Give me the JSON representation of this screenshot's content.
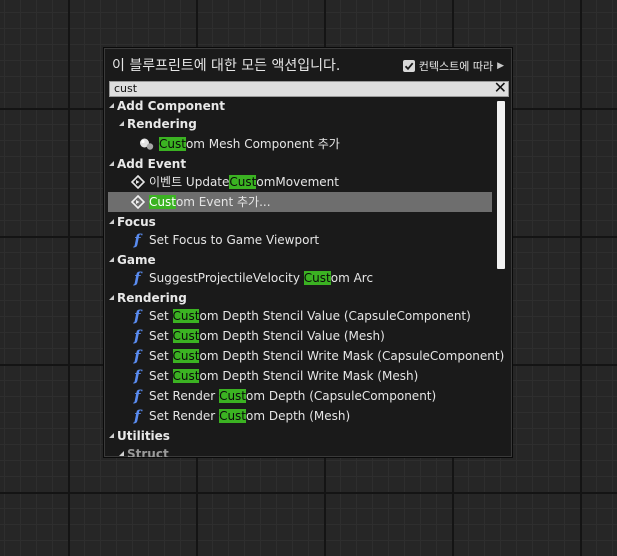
{
  "header": {
    "title": "이 블루프린트에 대한 모든 액션입니다.",
    "context_label": "컨텍스트에 따라",
    "context_checked": true
  },
  "search": {
    "value": "cust"
  },
  "list": {
    "cat_add_component": "Add Component",
    "subcat_rendering": "Rendering",
    "item_custom_mesh": {
      "hl": "Cust",
      "rest": "om Mesh Component 추가"
    },
    "cat_add_event": "Add Event",
    "item_update_custom": {
      "pre": "이벤트 Update",
      "hl": "Cust",
      "rest": "omMovement"
    },
    "item_custom_event": {
      "hl": "Cust",
      "rest": "om Event 추가..."
    },
    "cat_focus": "Focus",
    "item_set_focus": "Set Focus to Game Viewport",
    "cat_game": "Game",
    "item_suggest": {
      "pre": "SuggestProjectileVelocity ",
      "hl": "Cust",
      "rest": "om Arc"
    },
    "cat_rendering": "Rendering",
    "rendering_items": [
      {
        "pre": "Set ",
        "hl": "Cust",
        "rest": "om Depth Stencil Value (CapsuleComponent)"
      },
      {
        "pre": "Set ",
        "hl": "Cust",
        "rest": "om Depth Stencil Value (Mesh)"
      },
      {
        "pre": "Set ",
        "hl": "Cust",
        "rest": "om Depth Stencil Write Mask (CapsuleComponent)"
      },
      {
        "pre": "Set ",
        "hl": "Cust",
        "rest": "om Depth Stencil Write Mask (Mesh)"
      },
      {
        "pre": "Set Render ",
        "hl": "Cust",
        "rest": "om Depth (CapsuleComponent)"
      },
      {
        "pre": "Set Render ",
        "hl": "Cust",
        "rest": "om Depth (Mesh)"
      }
    ],
    "cat_utilities": "Utilities",
    "subcat_struct": "Struct"
  },
  "icons": {
    "function": "function-f-icon",
    "event": "event-diamond-icon",
    "component": "component-sphere-icon"
  },
  "colors": {
    "highlight": "#3bb222",
    "function_icon": "#5a8cf0",
    "selected_row": "#6e6e6e"
  }
}
